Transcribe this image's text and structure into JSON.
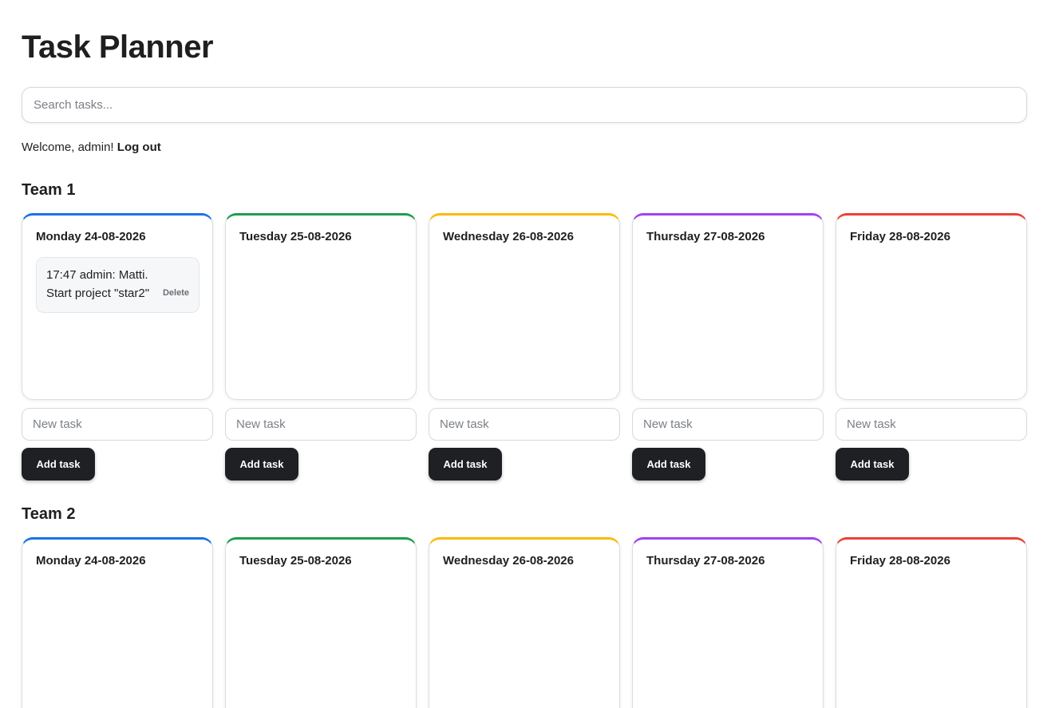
{
  "app": {
    "title": "Task Planner"
  },
  "search": {
    "placeholder": "Search tasks..."
  },
  "user": {
    "welcome": "Welcome, admin!",
    "logout_label": "Log out"
  },
  "accent_colors": {
    "monday": "#1a73e8",
    "tuesday": "#1e9e4f",
    "wednesday": "#fbbc04",
    "thursday": "#a142f4",
    "friday": "#ea4335"
  },
  "teams": [
    {
      "name": "Team 1",
      "days": [
        {
          "label": "Monday 24-08-2026",
          "tasks": [
            {
              "text": "17:47 admin: Matti. Start project \"star2\"",
              "delete_label": "Delete"
            }
          ],
          "new_task_placeholder": "New task",
          "add_label": "Add task"
        },
        {
          "label": "Tuesday 25-08-2026",
          "tasks": [],
          "new_task_placeholder": "New task",
          "add_label": "Add task"
        },
        {
          "label": "Wednesday 26-08-2026",
          "tasks": [],
          "new_task_placeholder": "New task",
          "add_label": "Add task"
        },
        {
          "label": "Thursday 27-08-2026",
          "tasks": [],
          "new_task_placeholder": "New task",
          "add_label": "Add task"
        },
        {
          "label": "Friday 28-08-2026",
          "tasks": [],
          "new_task_placeholder": "New task",
          "add_label": "Add task"
        }
      ]
    },
    {
      "name": "Team 2",
      "days": [
        {
          "label": "Monday 24-08-2026",
          "tasks": []
        },
        {
          "label": "Tuesday 25-08-2026",
          "tasks": []
        },
        {
          "label": "Wednesday 26-08-2026",
          "tasks": []
        },
        {
          "label": "Thursday 27-08-2026",
          "tasks": []
        },
        {
          "label": "Friday 28-08-2026",
          "tasks": []
        }
      ]
    }
  ]
}
